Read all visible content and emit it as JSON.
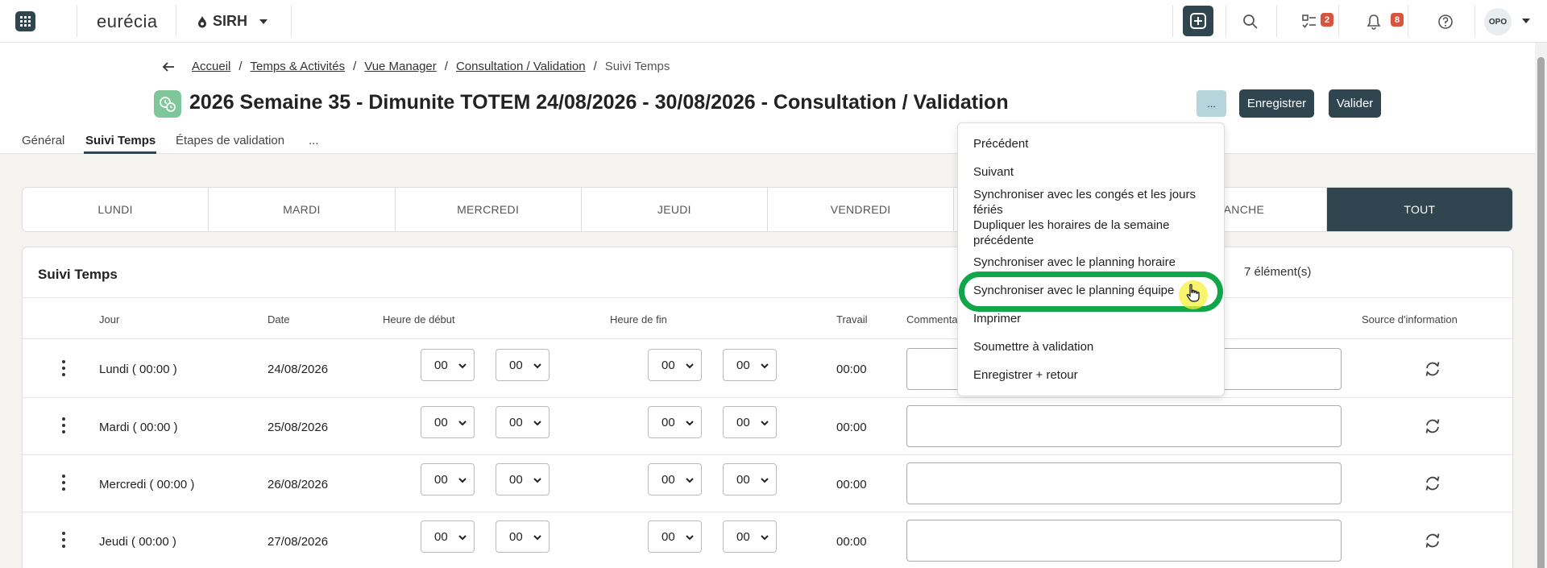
{
  "topbar": {
    "logo": "eurécia",
    "module": "SIRH",
    "tasks_badge": "2",
    "notifications_badge": "8",
    "user_initials": "OPO"
  },
  "breadcrumb": {
    "items": [
      "Accueil",
      "Temps & Activités",
      "Vue Manager",
      "Consultation / Validation"
    ],
    "current": "Suivi Temps"
  },
  "header": {
    "title": "2026 Semaine 35 - Dimunite TOTEM 24/08/2026 - 30/08/2026 - Consultation / Validation",
    "more_label": "...",
    "save_label": "Enregistrer",
    "validate_label": "Valider"
  },
  "tabs": [
    "Général",
    "Suivi Temps",
    "Étapes de validation",
    "..."
  ],
  "day_tabs": [
    "LUNDI",
    "MARDI",
    "MERCREDI",
    "JEUDI",
    "VENDREDI",
    "DIMANCHE",
    "TOUT"
  ],
  "card": {
    "title": "Suivi Temps",
    "count": "7 élément(s)",
    "columns": [
      "Jour",
      "Date",
      "Heure de début",
      "Heure de fin",
      "Travail",
      "Commentaire",
      "Source d'information"
    ]
  },
  "rows": [
    {
      "day": "Lundi ( 00:00 )",
      "date": "24/08/2026",
      "start_h": "00",
      "start_m": "00",
      "end_h": "00",
      "end_m": "00",
      "work": "00:00"
    },
    {
      "day": "Mardi ( 00:00 )",
      "date": "25/08/2026",
      "start_h": "00",
      "start_m": "00",
      "end_h": "00",
      "end_m": "00",
      "work": "00:00"
    },
    {
      "day": "Mercredi ( 00:00 )",
      "date": "26/08/2026",
      "start_h": "00",
      "start_m": "00",
      "end_h": "00",
      "end_m": "00",
      "work": "00:00"
    },
    {
      "day": "Jeudi ( 00:00 )",
      "date": "27/08/2026",
      "start_h": "00",
      "start_m": "00",
      "end_h": "00",
      "end_m": "00",
      "work": "00:00"
    }
  ],
  "menu": {
    "items": [
      "Précédent",
      "Suivant",
      "Synchroniser avec les congés et les jours fériés",
      "Dupliquer les horaires de la semaine précédente",
      "Synchroniser avec le planning horaire",
      "Synchroniser avec le planning équipe",
      "Imprimer",
      "Soumettre à validation",
      "Enregistrer + retour"
    ]
  },
  "colors": {
    "primary_dark": "#2f4550",
    "highlight": "#12a64a",
    "badge": "#d9543f"
  }
}
